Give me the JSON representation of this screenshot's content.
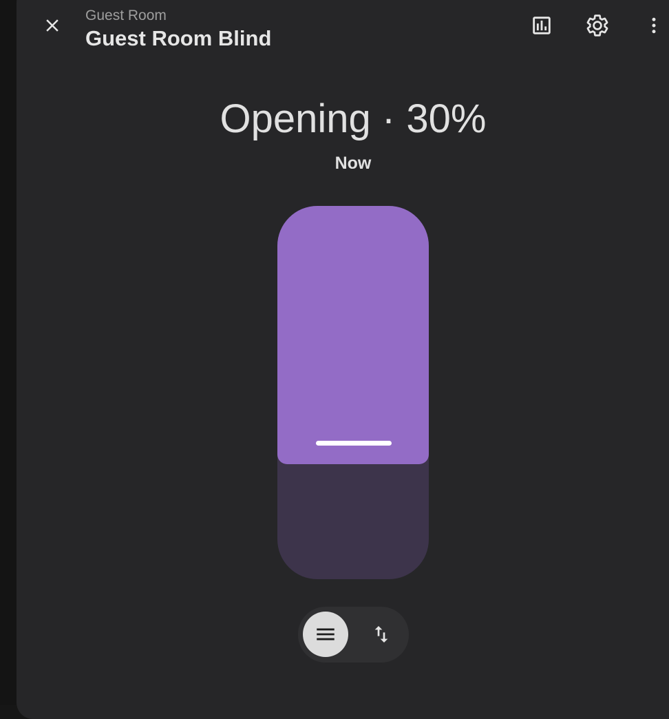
{
  "header": {
    "breadcrumb": "Guest Room",
    "title": "Guest Room Blind",
    "icons": {
      "close": "close-icon",
      "history": "chart-box-icon",
      "settings": "gear-icon",
      "more": "dots-vertical-icon"
    }
  },
  "state": {
    "label": "Opening · 30%",
    "time": "Now",
    "position_percent": 30
  },
  "mode_toggle": {
    "options": [
      "position-slider",
      "up-down-buttons"
    ],
    "selected": "position-slider"
  },
  "colors": {
    "accent": "#936cc6",
    "track": "#3d344b",
    "surface": "#262628"
  }
}
